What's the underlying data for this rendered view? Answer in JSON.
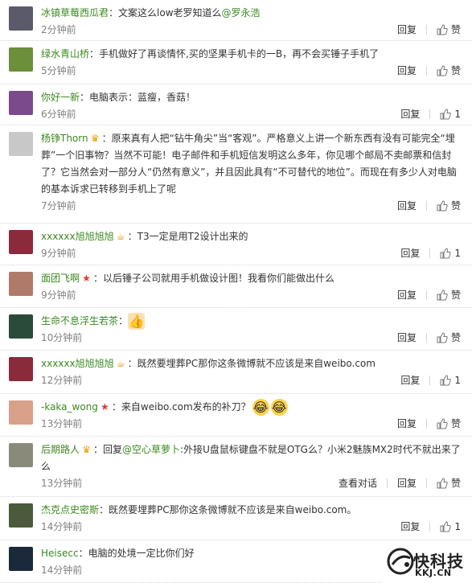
{
  "comments": [
    {
      "user": "冰镇草莓西瓜君",
      "badge": "",
      "text": "：文案这么low老罗知道么",
      "mention": "@罗永浩",
      "text2": "",
      "time": "2分钟前",
      "actions": [
        "回复"
      ],
      "likes": "",
      "like_label": "赞",
      "avatar_color": "#5a5a6a"
    },
    {
      "user": "绿水青山桥",
      "badge": "",
      "text": "：手机做好了再谈情怀,买的坚果手机卡的一B，再不会买锤子手机了",
      "mention": "",
      "text2": "",
      "time": "5分钟前",
      "actions": [
        "回复"
      ],
      "likes": "",
      "like_label": "赞",
      "avatar_color": "#6b8f3a"
    },
    {
      "user": "你好一新",
      "badge": "",
      "text": "：电脑表示：蓝瘦，香菇！",
      "mention": "",
      "text2": "",
      "time": "6分钟前",
      "actions": [
        "回复"
      ],
      "likes": "1",
      "like_label": "",
      "avatar_color": "#7a4a8c"
    },
    {
      "user": "杨铮Thorn",
      "badge": "crown",
      "text": "：原来真有人把“钻牛角尖”当“客观”。严格意义上讲一个新东西有没有可能完全“埋葬”一个旧事物？当然不可能！电子邮件和手机短信发明这么多年，你见哪个邮局不卖邮票和信封了？它当然会对一部分人“仍然有意义”，并且因此具有“不可替代的地位”。而现在有多少人对电脑的基本诉求已转移到手机上了呢",
      "mention": "",
      "text2": "",
      "time": "7分钟前",
      "actions": [
        "回复"
      ],
      "likes": "",
      "like_label": "赞",
      "avatar_color": "#c8c8c8"
    },
    {
      "user": "xxxxxx旭旭旭旭",
      "badge": "cup",
      "text": "：T3一定是用T2设计出来的",
      "mention": "",
      "text2": "",
      "time": "9分钟前",
      "actions": [
        "回复"
      ],
      "likes": "1",
      "like_label": "",
      "avatar_color": "#8a2a3a"
    },
    {
      "user": "面团飞啊",
      "badge": "star",
      "text": "：以后锤子公司就用手机做设计图！我看你们能做出什么",
      "mention": "",
      "text2": "",
      "time": "9分钟前",
      "actions": [
        "回复"
      ],
      "likes": "",
      "like_label": "赞",
      "avatar_color": "#b07a6a"
    },
    {
      "user": "生命不息浮生若茶",
      "badge": "",
      "text": "：",
      "mention": "",
      "text2": "",
      "emoji": "thumbs-up",
      "time": "10分钟前",
      "actions": [
        "回复"
      ],
      "likes": "",
      "like_label": "赞",
      "avatar_color": "#2a4a3a"
    },
    {
      "user": "xxxxxx旭旭旭旭",
      "badge": "cup",
      "text": "：既然要埋葬PC那你这条微博就不应该是来自weibo.com",
      "mention": "",
      "text2": "",
      "time": "12分钟前",
      "actions": [
        "回复"
      ],
      "likes": "1",
      "like_label": "",
      "avatar_color": "#8a2a3a"
    },
    {
      "user": "-kaka_wong",
      "badge": "star",
      "text": "：来自weibo.com发布的补刀？",
      "mention": "",
      "text2": "",
      "emoji": "laugh-cry",
      "time": "13分钟前",
      "actions": [
        "回复"
      ],
      "likes": "",
      "like_label": "赞",
      "avatar_color": "#d9a08a"
    },
    {
      "user": "后期路人",
      "badge": "crown",
      "text": "：回复",
      "mention": "@空心草萝卜",
      "text2": ":外接U盘鼠标键盘不就是OTG么？小米2魅族MX2时代不就出来了么",
      "time": "13分钟前",
      "actions": [
        "查看对话",
        "回复"
      ],
      "likes": "",
      "like_label": "赞",
      "avatar_color": "#8a8a7a"
    },
    {
      "user": "杰克点史密斯",
      "badge": "",
      "text": "：既然要埋葬PC那你这条微博就不应该是来自weibo.com。",
      "mention": "",
      "text2": "",
      "time": "14分钟前",
      "actions": [
        "回复"
      ],
      "likes": "1",
      "like_label": "",
      "avatar_color": "#4a5a3a"
    },
    {
      "user": "Heisecc",
      "badge": "",
      "text": "：电脑的处境一定比你们好",
      "mention": "",
      "text2": "",
      "time": "14分钟前",
      "actions": [],
      "likes": "",
      "like_label": "",
      "avatar_color": "#1a2a3a"
    }
  ],
  "watermark": {
    "name": "快科技",
    "url": "KKJ.CN"
  },
  "colors": {
    "username": "#3b8a1f",
    "time": "#808080",
    "text": "#333333",
    "divider": "#d6d6d6"
  }
}
